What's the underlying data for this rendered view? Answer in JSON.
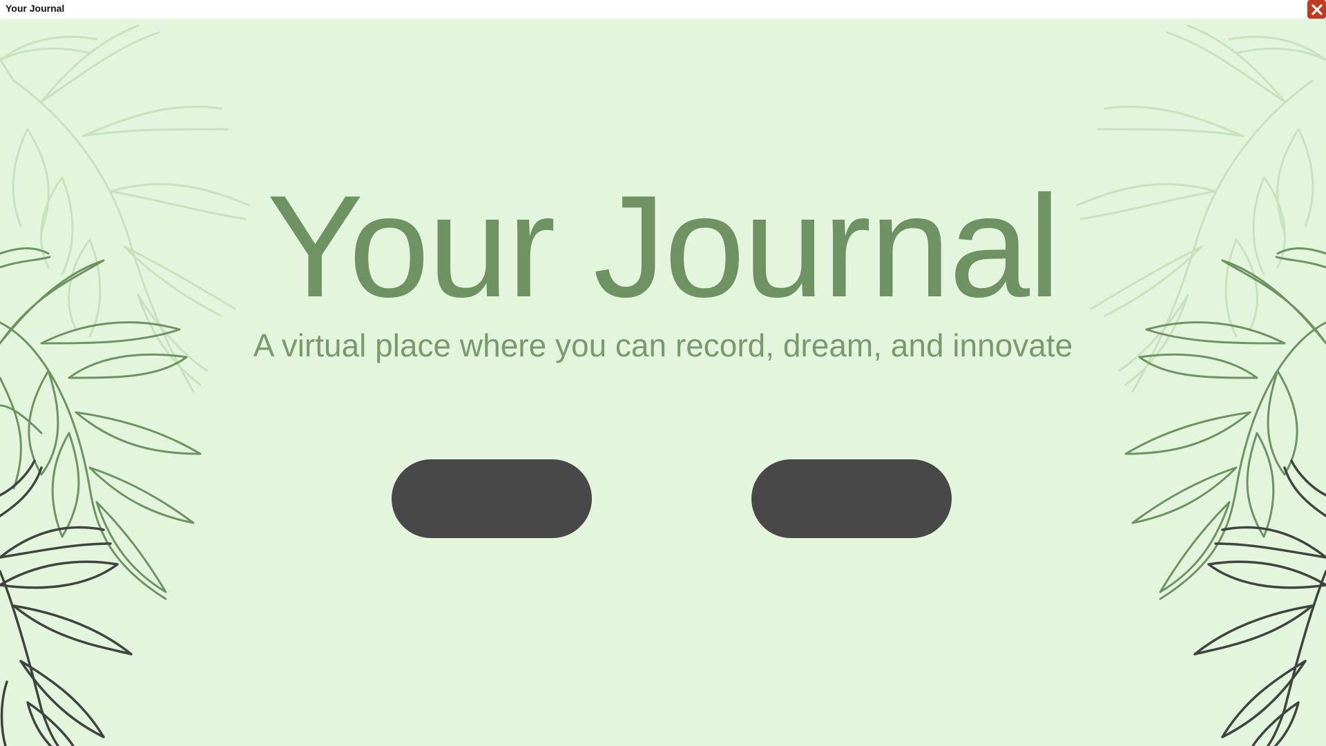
{
  "window": {
    "title": "Your Journal",
    "close_icon": "close-icon"
  },
  "hero": {
    "title": "Your Journal",
    "subtitle": "A virtual place where you can record, dream, and innovate"
  },
  "actions": {
    "primary_label": "",
    "secondary_label": ""
  },
  "colors": {
    "background": "#e3f5dd",
    "title": "#6e9262",
    "subtitle": "#7a9a6e",
    "button": "#484848",
    "close_button": "#c03a1e",
    "leaf_light": "#c7e2bc",
    "leaf_mid": "#6e9262",
    "leaf_dark": "#3f4441"
  },
  "decorations": {
    "left_foliage": "fern-leaves",
    "right_foliage": "fern-leaves"
  }
}
